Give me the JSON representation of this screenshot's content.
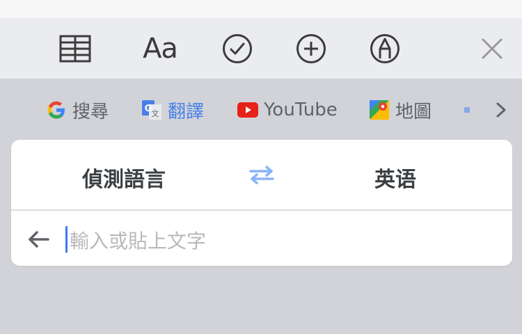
{
  "toolbar": {
    "items": [
      {
        "name": "table-icon"
      },
      {
        "name": "format-text-button",
        "label": "Aa"
      },
      {
        "name": "checklist-icon"
      },
      {
        "name": "add-icon"
      },
      {
        "name": "markup-pen-icon"
      },
      {
        "name": "close-icon"
      }
    ]
  },
  "shortcuts": {
    "search": {
      "label": "搜尋",
      "icon": "google-g-icon"
    },
    "translate": {
      "label": "翻譯",
      "icon": "google-translate-icon",
      "active": true
    },
    "youtube": {
      "label": "YouTube",
      "icon": "youtube-icon"
    },
    "maps": {
      "label": "地圖",
      "icon": "google-maps-icon"
    },
    "more": {
      "icon": "chevron-right-icon"
    }
  },
  "translate": {
    "source_lang": "偵測語言",
    "target_lang": "英语",
    "input_placeholder": "輸入或貼上文字"
  },
  "colors": {
    "accent_blue": "#4a7fe8",
    "youtube_red": "#e62117",
    "toolbar_bg": "#ebecef",
    "keyboard_bg": "#d1d3d8"
  }
}
